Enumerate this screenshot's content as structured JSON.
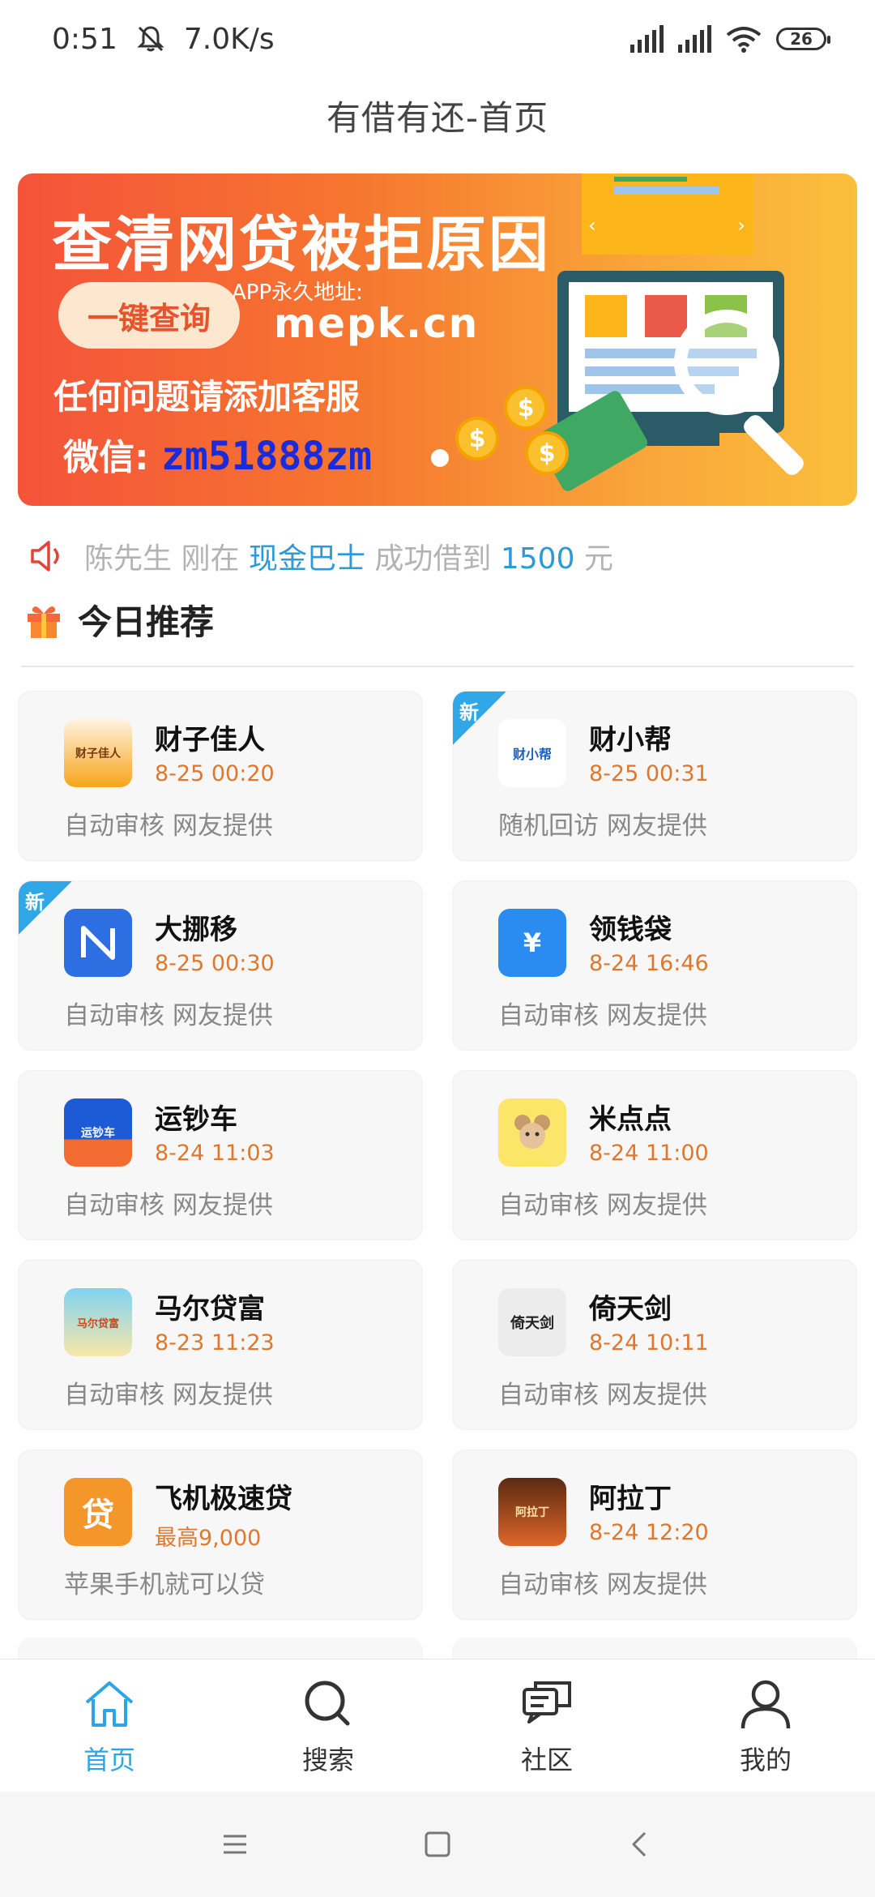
{
  "status_bar": {
    "time": "0:51",
    "speed": "7.0K/s",
    "battery": "26"
  },
  "header": {
    "title": "有借有还-首页"
  },
  "banner": {
    "headline": "查清网贷被拒原因",
    "button_label": "一键查询",
    "app_label": "APP永久地址:",
    "app_url": "mepk.cn",
    "line1": "任何问题请添加客服",
    "wechat_label": "微信:",
    "wechat_id": "zm51888zm"
  },
  "ticker": {
    "name": "陈先生",
    "verb": "刚在",
    "product": "现金巴士",
    "action": "成功借到",
    "amount": "1500",
    "unit": "元"
  },
  "section": {
    "title": "今日推荐"
  },
  "products": [
    {
      "name": "财子佳人",
      "time": "8-25 00:20",
      "desc": "自动审核 网友提供",
      "is_new": false,
      "icon": "caizi-logo",
      "icon_text": "财子佳人"
    },
    {
      "name": "财小帮",
      "time": "8-25 00:31",
      "desc": "随机回访 网友提供",
      "is_new": true,
      "icon": "caixiaobang-logo",
      "icon_text": "财小帮"
    },
    {
      "name": "大挪移",
      "time": "8-25 00:30",
      "desc": "自动审核 网友提供",
      "is_new": true,
      "icon": "danuoyi-logo",
      "icon_text": ""
    },
    {
      "name": "领钱袋",
      "time": "8-24 16:46",
      "desc": "自动审核 网友提供",
      "is_new": false,
      "icon": "money-bag-logo",
      "icon_text": "¥"
    },
    {
      "name": "运钞车",
      "time": "8-24 11:03",
      "desc": "自动审核 网友提供",
      "is_new": false,
      "icon": "truck-logo",
      "icon_text": "运钞车"
    },
    {
      "name": "米点点",
      "time": "8-24 11:00",
      "desc": "自动审核 网友提供",
      "is_new": false,
      "icon": "mouse-logo",
      "icon_text": ""
    },
    {
      "name": "马尔贷富",
      "time": "8-23 11:23",
      "desc": "自动审核 网友提供",
      "is_new": false,
      "icon": "palm-logo",
      "icon_text": "马尔贷富"
    },
    {
      "name": "倚天剑",
      "time": "8-24 10:11",
      "desc": "自动审核 网友提供",
      "is_new": false,
      "icon": "calligraphy-logo",
      "icon_text": "倚天剑"
    },
    {
      "name": "飞机极速贷",
      "time": "最高9,000",
      "desc": "苹果手机就可以贷",
      "is_new": false,
      "icon": "dai-logo",
      "icon_text": "贷"
    },
    {
      "name": "阿拉丁",
      "time": "8-24 12:20",
      "desc": "自动审核 网友提供",
      "is_new": false,
      "icon": "aladdin-logo",
      "icon_text": "阿拉丁"
    }
  ],
  "new_badge": "新",
  "nav": {
    "items": [
      {
        "label": "首页",
        "icon": "home-icon",
        "active": true
      },
      {
        "label": "搜索",
        "icon": "search-icon",
        "active": false
      },
      {
        "label": "社区",
        "icon": "chat-icon",
        "active": false
      },
      {
        "label": "我的",
        "icon": "user-icon",
        "active": false
      }
    ]
  },
  "colors": {
    "accent": "#2aa6e8",
    "time_orange": "#e0772a",
    "banner_start": "#f4533a",
    "banner_end": "#fbbf3c"
  }
}
